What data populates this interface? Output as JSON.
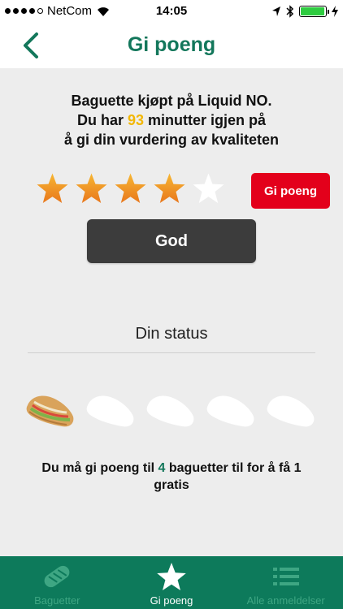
{
  "status_bar": {
    "carrier": "NetCom",
    "time": "14:05",
    "signal_bars": 4,
    "battery_level": 0.95
  },
  "nav": {
    "title": "Gi poeng",
    "back_icon": "chevron-left-icon"
  },
  "intro": {
    "line1": "Baguette kjøpt på Liquid NO.",
    "line2_prefix": "Du har ",
    "minutes": "93",
    "line2_suffix": " minutter igjen på",
    "line3": "å gi din vurdering av kvaliteten"
  },
  "rating": {
    "value": 4,
    "max": 5,
    "label": "God",
    "submit_label": "Gi poeng"
  },
  "status": {
    "heading": "Din status",
    "collected": 1,
    "total": 5,
    "note_prefix": "Du må gi poeng til ",
    "remaining": "4",
    "note_suffix": " baguetter til for å få 1 gratis"
  },
  "tabs": [
    {
      "label": "Baguetter",
      "icon": "bread-icon",
      "active": false
    },
    {
      "label": "Gi poeng",
      "icon": "star-icon",
      "active": true
    },
    {
      "label": "Alle anmeldelser",
      "icon": "list-icon",
      "active": false
    }
  ],
  "colors": {
    "brand_green": "#0d7a5b",
    "accent_red": "#e3001b",
    "star_orange": "#f39c12",
    "highlight_yellow": "#f2b705"
  }
}
